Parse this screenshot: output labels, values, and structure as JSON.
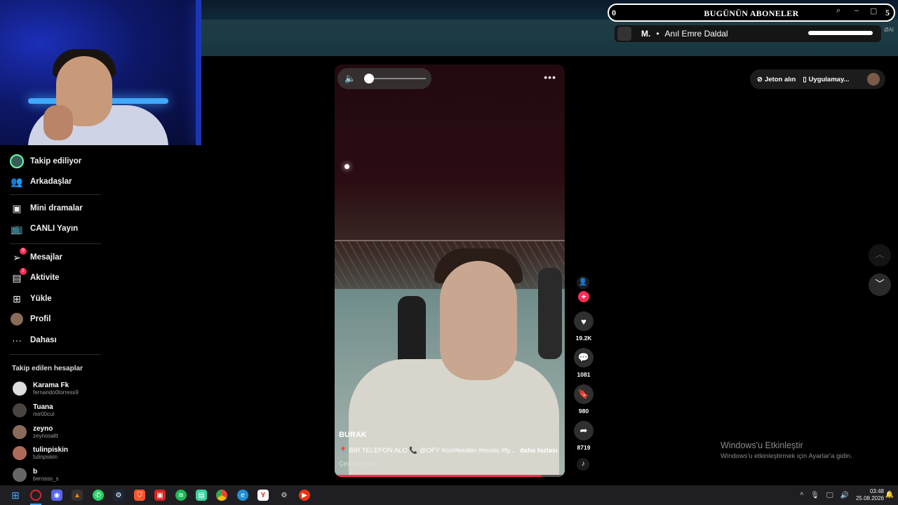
{
  "overlay": {
    "subs_title": "BUGÜNÜN ABONELER",
    "subs_count_left": "0",
    "subs_count_right": "5",
    "sub_initial": "M.",
    "sub_name": "Anıl Emre Daldal",
    "oai_label": "ØAI"
  },
  "sidebar": {
    "items": [
      {
        "label": "Takip ediliyor",
        "icon": "following-icon"
      },
      {
        "label": "Arkadaşlar",
        "icon": "friends-icon"
      },
      {
        "label": "Mini dramalar",
        "icon": "mini-drama-icon"
      },
      {
        "label": "CANLI Yayın",
        "icon": "live-icon"
      },
      {
        "label": "Mesajlar",
        "icon": "messages-icon",
        "badge": "9"
      },
      {
        "label": "Aktivite",
        "icon": "activity-icon",
        "badge": "1"
      },
      {
        "label": "Yükle",
        "icon": "upload-icon"
      },
      {
        "label": "Profil",
        "icon": "profile-icon"
      },
      {
        "label": "Dahası",
        "icon": "more-icon"
      }
    ],
    "following_header": "Takip edilen hesaplar",
    "following": [
      {
        "name": "Karama Fk",
        "username": "fernando0torress9"
      },
      {
        "name": "Tuana",
        "username": "mir00cul"
      },
      {
        "name": "zeyno",
        "username": "zeynosaltt"
      },
      {
        "name": "tulinpiskin",
        "username": "tulinpiskin"
      },
      {
        "name": "b",
        "username": "berosss_s"
      }
    ]
  },
  "video": {
    "author": "BURAK",
    "description": "📍 BİR TELEFON ALO 📞 @OFY #ozi#keskin #music #fy...",
    "more_label": "daha fazlası",
    "translate_label": "Çevirisini gör",
    "progress_fraction": 0.9
  },
  "actions": {
    "likes": "19.2K",
    "comments": "1081",
    "saves": "980",
    "shares": "8719"
  },
  "topbar": {
    "coins_label": "Jeton alın",
    "app_label": "Uygulamay..."
  },
  "windows": {
    "activate_title": "Windows'u Etkinleştir",
    "activate_sub": "Windows'u etkinleştirmek için Ayarlar'a gidin.",
    "time": "03:48",
    "date": "25.08.2026"
  },
  "taskbar": {
    "apps": [
      "start-icon",
      "opera-icon",
      "discord-icon",
      "files-icon",
      "whatsapp-icon",
      "steam-icon",
      "brave-icon",
      "app-red-icon",
      "spotify-icon",
      "app-green-icon",
      "chrome-icon",
      "edge-icon",
      "yandex-icon",
      "settings-icon",
      "youtube-icon"
    ]
  },
  "colors": {
    "accent": "#fe2c55",
    "background": "#000000"
  }
}
